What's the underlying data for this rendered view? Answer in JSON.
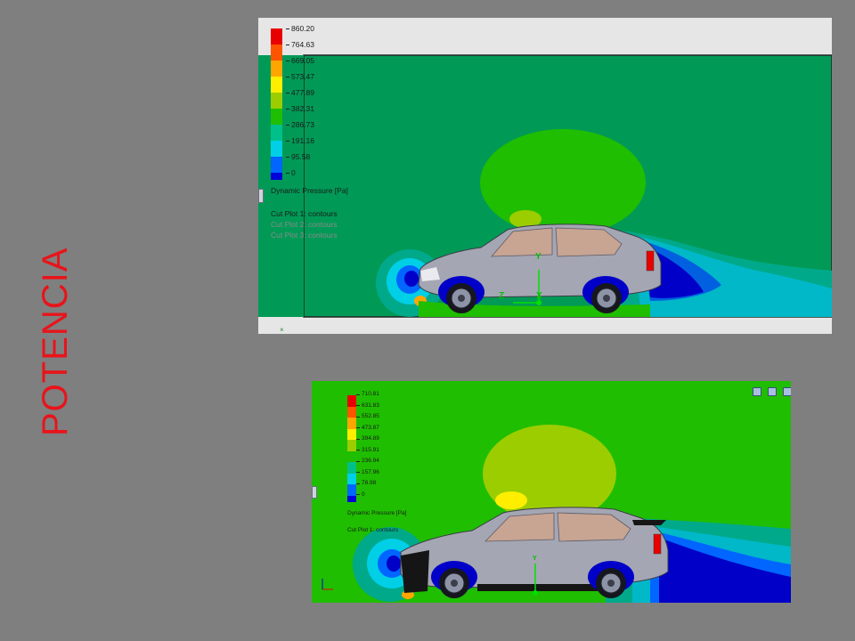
{
  "slide": {
    "title": "POTENCIA"
  },
  "screenshot_top": {
    "legend": {
      "ticks": [
        "860.20",
        "764.63",
        "669.05",
        "573.47",
        "477.89",
        "382.31",
        "286.73",
        "191.16",
        "95.58",
        "0"
      ],
      "colors": [
        "#e80000",
        "#ff5500",
        "#ffa500",
        "#ffee00",
        "#9ccd00",
        "#1fbe00",
        "#00c08a",
        "#00cfe6",
        "#0066ff",
        "#0000d8"
      ],
      "title": "Dynamic Pressure [Pa]"
    },
    "cut_plots": [
      "Cut Plot 1: contours",
      "Cut Plot 2: contours",
      "Cut Plot 3: contours"
    ],
    "axis_labels": {
      "y": "Y",
      "z": "Z",
      "x": "X"
    }
  },
  "screenshot_bottom": {
    "legend": {
      "ticks": [
        "710.81",
        "631.83",
        "552.85",
        "473.87",
        "394.89",
        "315.91",
        "236.94",
        "157.96",
        "78.98",
        "0"
      ],
      "colors": [
        "#e80000",
        "#ff5500",
        "#ffa500",
        "#ffee00",
        "#9ccd00",
        "#1fbe00",
        "#00c08a",
        "#00cfe6",
        "#0066ff",
        "#0000d8"
      ],
      "title": "Dynamic Pressure [Pa]"
    },
    "cut_plots": [
      "Cut Plot 1: contours"
    ],
    "axis_labels": {
      "y": "Y"
    }
  }
}
